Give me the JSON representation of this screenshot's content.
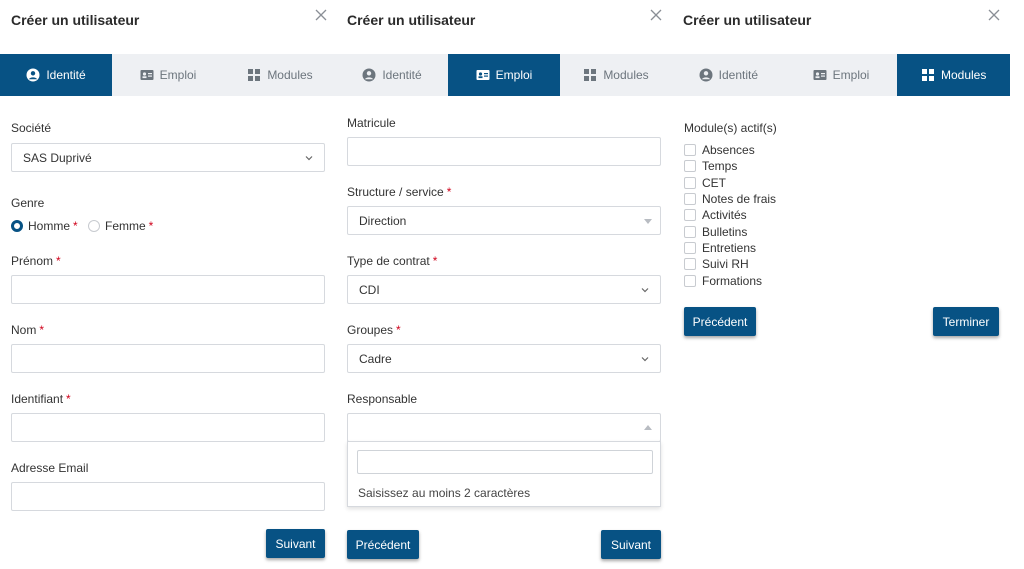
{
  "panels": [
    {
      "title": "Créer un utilisateur",
      "tabs": [
        {
          "label": "Identité",
          "icon": "user-circle-icon",
          "active": true
        },
        {
          "label": "Emploi",
          "icon": "id-card-icon",
          "active": false
        },
        {
          "label": "Modules",
          "icon": "grid-icon",
          "active": false
        }
      ],
      "societe_label": "Société",
      "societe_value": "SAS Duprivé",
      "genre_label": "Genre",
      "homme_label": "Homme",
      "femme_label": "Femme",
      "prenom_label": "Prénom",
      "nom_label": "Nom",
      "identifiant_label": "Identifiant",
      "email_label": "Adresse Email",
      "suivant_label": "Suivant",
      "required_mark": "*"
    },
    {
      "title": "Créer un utilisateur",
      "tabs": [
        {
          "label": "Identité",
          "icon": "user-circle-icon",
          "active": false
        },
        {
          "label": "Emploi",
          "icon": "id-card-icon",
          "active": true
        },
        {
          "label": "Modules",
          "icon": "grid-icon",
          "active": false
        }
      ],
      "matricule_label": "Matricule",
      "structure_label": "Structure / service",
      "structure_value": "Direction",
      "contrat_label": "Type de contrat",
      "contrat_value": "CDI",
      "groupes_label": "Groupes",
      "groupes_value": "Cadre",
      "responsable_label": "Responsable",
      "responsable_hint": "Saisissez au moins 2 caractères",
      "precedent_label": "Précédent",
      "suivant_label": "Suivant",
      "required_mark": "*"
    },
    {
      "title": "Créer un utilisateur",
      "tabs": [
        {
          "label": "Identité",
          "icon": "user-circle-icon",
          "active": false
        },
        {
          "label": "Emploi",
          "icon": "id-card-icon",
          "active": false
        },
        {
          "label": "Modules",
          "icon": "grid-icon",
          "active": true
        }
      ],
      "modules_label": "Module(s) actif(s)",
      "modules": [
        "Absences",
        "Temps",
        "CET",
        "Notes de frais",
        "Activités",
        "Bulletins",
        "Entretiens",
        "Suivi RH",
        "Formations"
      ],
      "precedent_label": "Précédent",
      "terminer_label": "Terminer"
    }
  ],
  "colors": {
    "accent": "#075284",
    "required": "#d0021b",
    "tab_bg": "#eef0f3"
  }
}
